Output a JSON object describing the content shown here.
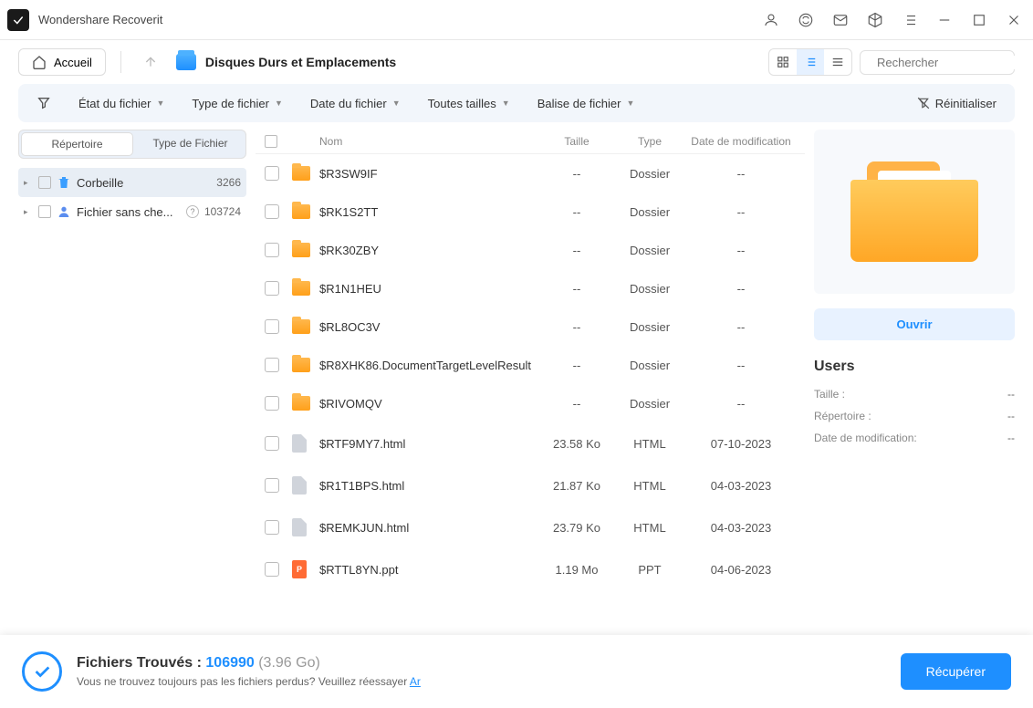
{
  "app": {
    "title": "Wondershare Recoverit"
  },
  "toolbar": {
    "home": "Accueil",
    "breadcrumb": "Disques Durs et Emplacements",
    "search_placeholder": "Rechercher"
  },
  "filters": {
    "state": "État du fichier",
    "type": "Type de fichier",
    "date": "Date du fichier",
    "size": "Toutes tailles",
    "tag": "Balise de fichier",
    "reset": "Réinitialiser"
  },
  "sidebar": {
    "tab_directory": "Répertoire",
    "tab_filetype": "Type de Fichier",
    "items": [
      {
        "label": "Corbeille",
        "count": "3266",
        "icon": "trash"
      },
      {
        "label": "Fichier sans che...",
        "count": "103724",
        "icon": "person"
      }
    ]
  },
  "columns": {
    "name": "Nom",
    "size": "Taille",
    "type": "Type",
    "date": "Date de modification"
  },
  "files": [
    {
      "name": "$R3SW9IF",
      "size": "--",
      "type": "Dossier",
      "date": "--",
      "icon": "folder"
    },
    {
      "name": "$RK1S2TT",
      "size": "--",
      "type": "Dossier",
      "date": "--",
      "icon": "folder"
    },
    {
      "name": "$RK30ZBY",
      "size": "--",
      "type": "Dossier",
      "date": "--",
      "icon": "folder"
    },
    {
      "name": "$R1N1HEU",
      "size": "--",
      "type": "Dossier",
      "date": "--",
      "icon": "folder"
    },
    {
      "name": "$RL8OC3V",
      "size": "--",
      "type": "Dossier",
      "date": "--",
      "icon": "folder"
    },
    {
      "name": "$R8XHK86.DocumentTargetLevelResult",
      "size": "--",
      "type": "Dossier",
      "date": "--",
      "icon": "folder"
    },
    {
      "name": "$RIVOMQV",
      "size": "--",
      "type": "Dossier",
      "date": "--",
      "icon": "folder"
    },
    {
      "name": "$RTF9MY7.html",
      "size": "23.58 Ko",
      "type": "HTML",
      "date": "07-10-2023",
      "icon": "doc"
    },
    {
      "name": "$R1T1BPS.html",
      "size": "21.87 Ko",
      "type": "HTML",
      "date": "04-03-2023",
      "icon": "doc"
    },
    {
      "name": "$REMKJUN.html",
      "size": "23.79 Ko",
      "type": "HTML",
      "date": "04-03-2023",
      "icon": "doc"
    },
    {
      "name": "$RTTL8YN.ppt",
      "size": "1.19 Mo",
      "type": "PPT",
      "date": "04-06-2023",
      "icon": "ppt"
    }
  ],
  "preview": {
    "open": "Ouvrir",
    "title": "Users",
    "meta": [
      {
        "label": "Taille :",
        "value": "--"
      },
      {
        "label": "Répertoire :",
        "value": "--"
      },
      {
        "label": "Date de modification:",
        "value": "--"
      }
    ]
  },
  "bottom": {
    "found_label": "Fichiers Trouvés : ",
    "found_count": "106990",
    "found_size": " (3.96 Go)",
    "hint": "Vous ne trouvez toujours pas les fichiers perdus? Veuillez réessayer ",
    "hint_link": "Ar",
    "recover": "Récupérer"
  }
}
